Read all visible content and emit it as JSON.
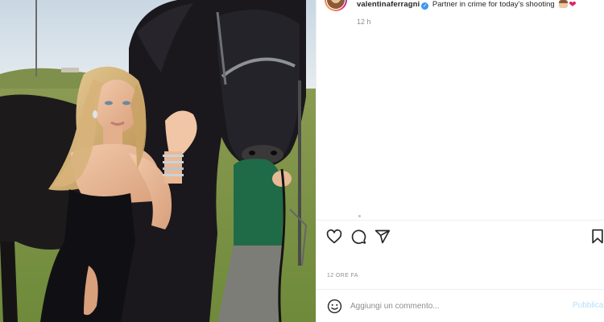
{
  "post": {
    "username": "valentinaferragni",
    "caption": "Partner in crime for today's shooting",
    "caption_emojis": [
      "girl-emoji",
      "heart-emoji"
    ],
    "time_ago": "12 h",
    "likes_time": "12 ORE FA"
  },
  "comment": {
    "placeholder": "Aggiungi un commento...",
    "publish_label": "Pubblica"
  },
  "colors": {
    "accent": "#3897f0",
    "publish_disabled": "#b2dffc",
    "muted": "#8e8e8e",
    "text": "#262626"
  },
  "icons": [
    "heart-icon",
    "comment-icon",
    "share-icon",
    "bookmark-icon",
    "emoji-icon",
    "verified-icon"
  ]
}
